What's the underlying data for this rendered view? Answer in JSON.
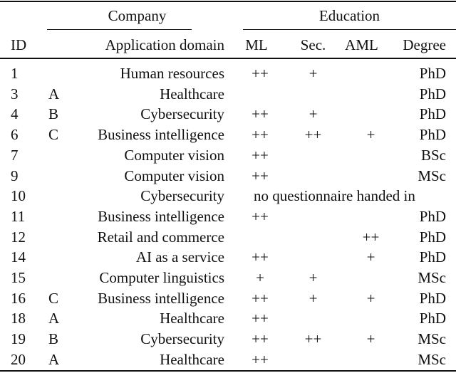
{
  "table": {
    "group_headers": {
      "company": "Company",
      "education": "Education"
    },
    "columns": {
      "id": "ID",
      "company_code": "",
      "domain": "Application domain",
      "ml": "ML",
      "sec": "Sec.",
      "aml": "AML",
      "degree": "Degree"
    },
    "rows": [
      {
        "id": "1",
        "company": "",
        "domain": "Human resources",
        "ml": "++",
        "sec": "+",
        "aml": "",
        "degree": "PhD",
        "note": ""
      },
      {
        "id": "3",
        "company": "A",
        "domain": "Healthcare",
        "ml": "",
        "sec": "",
        "aml": "",
        "degree": "PhD",
        "note": ""
      },
      {
        "id": "4",
        "company": "B",
        "domain": "Cybersecurity",
        "ml": "++",
        "sec": "+",
        "aml": "",
        "degree": "PhD",
        "note": ""
      },
      {
        "id": "6",
        "company": "C",
        "domain": "Business intelligence",
        "ml": "++",
        "sec": "++",
        "aml": "+",
        "degree": "PhD",
        "note": ""
      },
      {
        "id": "7",
        "company": "",
        "domain": "Computer vision",
        "ml": "++",
        "sec": "",
        "aml": "",
        "degree": "BSc",
        "note": ""
      },
      {
        "id": "9",
        "company": "",
        "domain": "Computer vision",
        "ml": "++",
        "sec": "",
        "aml": "",
        "degree": "MSc",
        "note": ""
      },
      {
        "id": "10",
        "company": "",
        "domain": "Cybersecurity",
        "ml": "",
        "sec": "",
        "aml": "",
        "degree": "",
        "note": "no questionnaire handed in"
      },
      {
        "id": "11",
        "company": "",
        "domain": "Business intelligence",
        "ml": "++",
        "sec": "",
        "aml": "",
        "degree": "PhD",
        "note": ""
      },
      {
        "id": "12",
        "company": "",
        "domain": "Retail and commerce",
        "ml": "",
        "sec": "",
        "aml": "++",
        "degree": "PhD",
        "note": ""
      },
      {
        "id": "14",
        "company": "",
        "domain": "AI as a service",
        "ml": "++",
        "sec": "",
        "aml": "+",
        "degree": "PhD",
        "note": ""
      },
      {
        "id": "15",
        "company": "",
        "domain": "Computer linguistics",
        "ml": "+",
        "sec": "+",
        "aml": "",
        "degree": "MSc",
        "note": ""
      },
      {
        "id": "16",
        "company": "C",
        "domain": "Business intelligence",
        "ml": "++",
        "sec": "+",
        "aml": "+",
        "degree": "PhD",
        "note": ""
      },
      {
        "id": "18",
        "company": "A",
        "domain": "Healthcare",
        "ml": "++",
        "sec": "",
        "aml": "",
        "degree": "PhD",
        "note": ""
      },
      {
        "id": "19",
        "company": "B",
        "domain": "Cybersecurity",
        "ml": "++",
        "sec": "++",
        "aml": "+",
        "degree": "MSc",
        "note": ""
      },
      {
        "id": "20",
        "company": "A",
        "domain": "Healthcare",
        "ml": "++",
        "sec": "",
        "aml": "",
        "degree": "MSc",
        "note": ""
      }
    ]
  }
}
